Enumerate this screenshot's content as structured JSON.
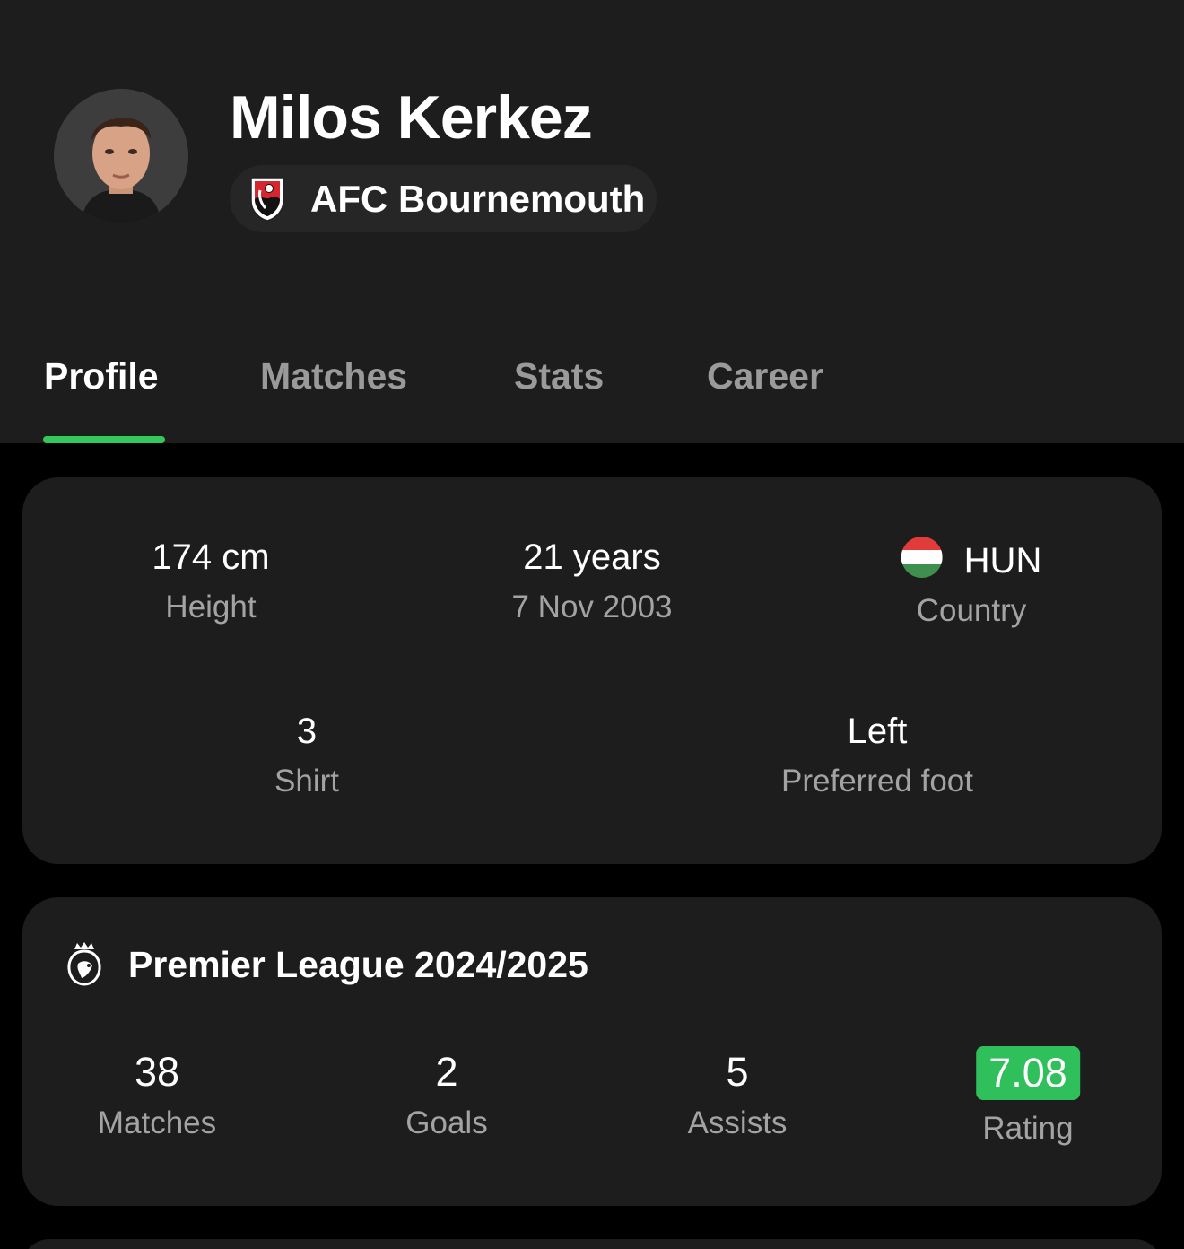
{
  "player": {
    "name": "Milos Kerkez",
    "club": "AFC Bournemouth"
  },
  "tabs": [
    {
      "label": "Profile",
      "active": true
    },
    {
      "label": "Matches",
      "active": false
    },
    {
      "label": "Stats",
      "active": false
    },
    {
      "label": "Career",
      "active": false
    }
  ],
  "info": {
    "height": {
      "value": "174 cm",
      "label": "Height"
    },
    "age": {
      "value": "21 years",
      "label": "7 Nov 2003"
    },
    "country": {
      "value": "HUN",
      "label": "Country"
    },
    "shirt": {
      "value": "3",
      "label": "Shirt"
    },
    "foot": {
      "value": "Left",
      "label": "Preferred foot"
    }
  },
  "league": {
    "title": "Premier League 2024/2025",
    "stats": [
      {
        "value": "38",
        "label": "Matches"
      },
      {
        "value": "2",
        "label": "Goals"
      },
      {
        "value": "5",
        "label": "Assists"
      },
      {
        "value": "7.08",
        "label": "Rating"
      }
    ]
  },
  "colors": {
    "accent": "#34c759",
    "rating_bg": "#2fbf5b",
    "background": "#000000",
    "surface": "#1d1d1d"
  },
  "icons": {
    "club_logo": "bournemouth-crest-icon",
    "league_logo": "premier-league-lion-icon",
    "country_flag": "hungary-flag-icon"
  }
}
